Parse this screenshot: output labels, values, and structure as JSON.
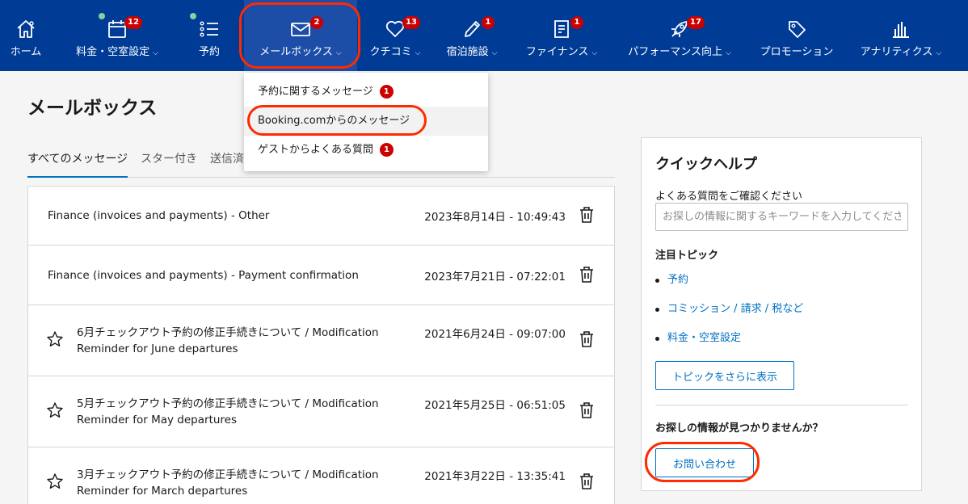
{
  "nav": {
    "items": [
      {
        "label": "ホーム",
        "chevron": false
      },
      {
        "label": "料金・空室設定",
        "badge": "12",
        "chevron": true
      },
      {
        "label": "予約",
        "chevron": false
      },
      {
        "label": "メールボックス",
        "badge": "2",
        "chevron": true
      },
      {
        "label": "クチコミ",
        "badge": "13",
        "chevron": true
      },
      {
        "label": "宿泊施設",
        "badge": "1",
        "chevron": true
      },
      {
        "label": "ファイナンス",
        "badge": "1",
        "chevron": true
      },
      {
        "label": "パフォーマンス向上",
        "badge": "17",
        "chevron": true
      },
      {
        "label": "プロモーション",
        "chevron": false
      },
      {
        "label": "アナリティクス",
        "chevron": true
      }
    ],
    "icons": [
      "home-icon",
      "calendar-icon",
      "list-icon",
      "envelope-icon",
      "heart-icon",
      "pencil-icon",
      "document-icon",
      "rocket-icon",
      "tag-icon",
      "bar-chart-icon"
    ],
    "accent": "#003b95"
  },
  "dropdown": {
    "items": [
      {
        "label": "予約に関するメッセージ",
        "badge": "1"
      },
      {
        "label": "Booking.comからのメッセージ"
      },
      {
        "label": "ゲストからよくある質問",
        "badge": "1"
      }
    ]
  },
  "page": {
    "title": "メールボックス",
    "tabs": [
      "すべてのメッセージ",
      "スター付き",
      "送信済"
    ]
  },
  "messages": [
    {
      "subject": "Finance (invoices and payments) - Other",
      "date": "2023年8月14日 - 10:49:43",
      "starred": false
    },
    {
      "subject": "Finance (invoices and payments) - Payment confirmation",
      "date": "2023年7月21日 - 07:22:01",
      "starred": false
    },
    {
      "subject_line1": "6月チェックアウト予約の修正手続きについて / Modification",
      "subject_line2": "Reminder for June departures",
      "date": "2021年6月24日 - 09:07:00",
      "star_icon": true
    },
    {
      "subject_line1": "5月チェックアウト予約の修正手続きについて / Modification",
      "subject_line2": "Reminder for May departures",
      "date": "2021年5月25日 - 06:51:05",
      "star_icon": true
    },
    {
      "subject_line1": "3月チェックアウト予約の修正手続きについて / Modification",
      "subject_line2": "Reminder for March departures",
      "date": "2021年3月22日 - 13:35:41",
      "star_icon": true
    }
  ],
  "help": {
    "title": "クイックヘルプ",
    "faq_label": "よくある質問をご確認ください",
    "search_placeholder": "お探しの情報に関するキーワードを入力してください",
    "topics_title": "注目トピック",
    "topics": [
      "予約",
      "コミッション / 請求 / 税など",
      "料金・空室設定"
    ],
    "more_topics_button": "トピックをさらに表示",
    "not_found": "お探しの情報が見つかりませんか？",
    "contact_button": "お問い合わせ"
  }
}
